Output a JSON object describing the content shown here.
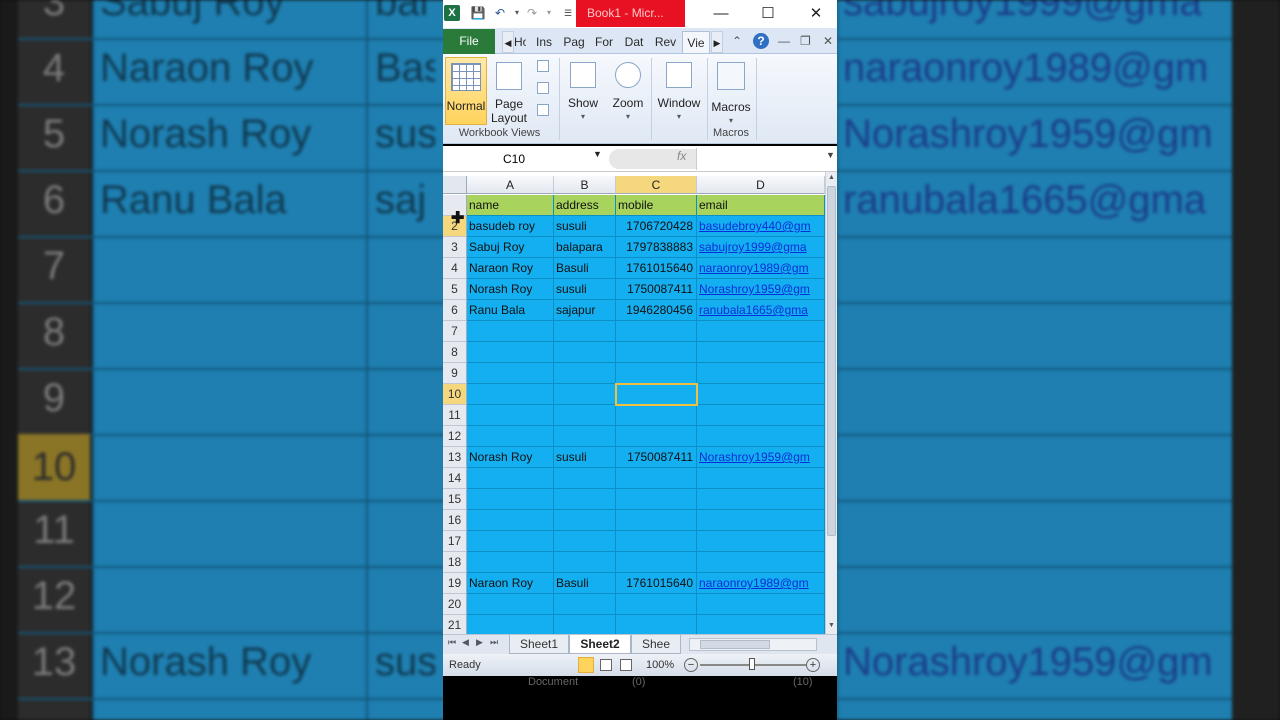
{
  "window": {
    "title": "Book1 - Micr..."
  },
  "ribbon": {
    "tabs": [
      "File",
      "Ho",
      "Ins",
      "Pag",
      "For",
      "Dat",
      "Rev",
      "Vie"
    ],
    "buttons": {
      "normal": "Normal",
      "page_layout_1": "Page",
      "page_layout_2": "Layout",
      "show": "Show",
      "zoom": "Zoom",
      "window": "Window",
      "macros": "Macros"
    },
    "groups": {
      "workbook_views": "Workbook Views",
      "macros": "Macros"
    }
  },
  "formula_bar": {
    "name_box": "C10",
    "formula": ""
  },
  "grid": {
    "columns": [
      "A",
      "B",
      "C",
      "D"
    ],
    "selected_column": "C",
    "active_cell": "C10",
    "rows": [
      {
        "num": "",
        "name": "name",
        "address": "address",
        "mobile": "mobile",
        "email": "email",
        "header": true
      },
      {
        "num": "2",
        "name": "basudeb roy",
        "address": "susuli",
        "mobile": "1706720428",
        "email": "basudebroy440@gm"
      },
      {
        "num": "3",
        "name": "Sabuj Roy",
        "address": "balapara",
        "mobile": "1797838883",
        "email": "sabujroy1999@gma"
      },
      {
        "num": "4",
        "name": "Naraon Roy",
        "address": "Basuli",
        "mobile": "1761015640",
        "email": "naraonroy1989@gm"
      },
      {
        "num": "5",
        "name": "Norash Roy",
        "address": "susuli",
        "mobile": "1750087411",
        "email": "Norashroy1959@gm"
      },
      {
        "num": "6",
        "name": "Ranu Bala",
        "address": "sajapur",
        "mobile": "1946280456",
        "email": "ranubala1665@gma"
      },
      {
        "num": "7",
        "name": "",
        "address": "",
        "mobile": "",
        "email": ""
      },
      {
        "num": "8",
        "name": "",
        "address": "",
        "mobile": "",
        "email": ""
      },
      {
        "num": "9",
        "name": "",
        "address": "",
        "mobile": "",
        "email": ""
      },
      {
        "num": "10",
        "name": "",
        "address": "",
        "mobile": "",
        "email": "",
        "selected": true
      },
      {
        "num": "11",
        "name": "",
        "address": "",
        "mobile": "",
        "email": ""
      },
      {
        "num": "12",
        "name": "",
        "address": "",
        "mobile": "",
        "email": ""
      },
      {
        "num": "13",
        "name": "Norash Roy",
        "address": "susuli",
        "mobile": "1750087411",
        "email": "Norashroy1959@gm"
      },
      {
        "num": "14",
        "name": "",
        "address": "",
        "mobile": "",
        "email": ""
      },
      {
        "num": "15",
        "name": "",
        "address": "",
        "mobile": "",
        "email": ""
      },
      {
        "num": "16",
        "name": "",
        "address": "",
        "mobile": "",
        "email": ""
      },
      {
        "num": "17",
        "name": "",
        "address": "",
        "mobile": "",
        "email": ""
      },
      {
        "num": "18",
        "name": "",
        "address": "",
        "mobile": "",
        "email": ""
      },
      {
        "num": "19",
        "name": "Naraon Roy",
        "address": "Basuli",
        "mobile": "1761015640",
        "email": "naraonroy1989@gm"
      },
      {
        "num": "20",
        "name": "",
        "address": "",
        "mobile": "",
        "email": ""
      },
      {
        "num": "21",
        "name": "",
        "address": "",
        "mobile": "",
        "email": ""
      }
    ]
  },
  "sheets": [
    "Sheet1",
    "Sheet2",
    "Shee"
  ],
  "active_sheet": "Sheet2",
  "status_bar": {
    "status": "Ready",
    "zoom": "100%"
  },
  "taskbar": {
    "document": "Document",
    "count1": "(0)",
    "count2": "(10)"
  },
  "background": {
    "rows": [
      {
        "num": "3",
        "name": "Sabuj Roy",
        "address": "bal",
        "email": "sabujroy1999@gma"
      },
      {
        "num": "4",
        "name": "Naraon Roy",
        "address": "Bas",
        "email": "naraonroy1989@gm"
      },
      {
        "num": "5",
        "name": "Norash Roy",
        "address": "sus",
        "email": "Norashroy1959@gm"
      },
      {
        "num": "6",
        "name": "Ranu Bala",
        "address": "saj",
        "email": "ranubala1665@gma"
      },
      {
        "num": "7"
      },
      {
        "num": "8"
      },
      {
        "num": "9"
      },
      {
        "num": "10"
      },
      {
        "num": "11"
      },
      {
        "num": "12"
      },
      {
        "num": "13",
        "name": "Norash Roy",
        "address": "sus",
        "email": "Norashroy1959@gm"
      }
    ]
  },
  "colors": {
    "cell_fill": "#13aff0",
    "header_fill": "#a8d45d",
    "selection": "#f5d87e",
    "link": "#0a2fd8",
    "file_tab": "#2a7a3a",
    "title_highlight": "#e81123"
  }
}
